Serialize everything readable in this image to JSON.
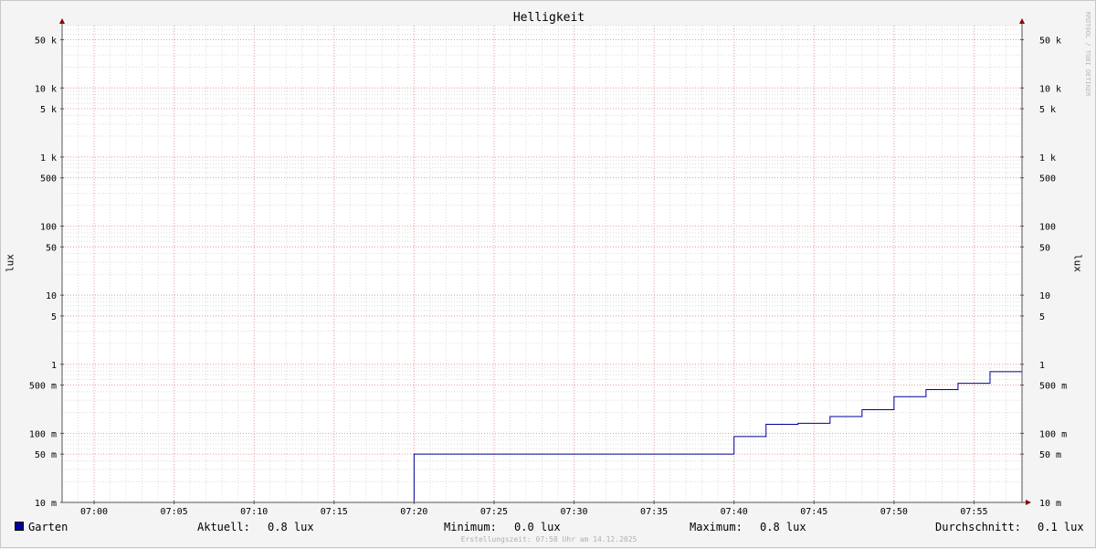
{
  "chart_data": {
    "type": "line",
    "title": "Helligkeit",
    "ylabel": "lux",
    "yscale": "log",
    "ylim": [
      0.01,
      80000
    ],
    "xlim": [
      "06:58",
      "07:58"
    ],
    "x_ticks": [
      "07:00",
      "07:05",
      "07:10",
      "07:15",
      "07:20",
      "07:25",
      "07:30",
      "07:35",
      "07:40",
      "07:45",
      "07:50",
      "07:55"
    ],
    "y_ticks": [
      {
        "value": 0.01,
        "label": "10 m"
      },
      {
        "value": 0.05,
        "label": "50 m"
      },
      {
        "value": 0.1,
        "label": "100 m"
      },
      {
        "value": 0.5,
        "label": "500 m"
      },
      {
        "value": 1,
        "label": "1"
      },
      {
        "value": 5,
        "label": "5"
      },
      {
        "value": 10,
        "label": "10"
      },
      {
        "value": 50,
        "label": "50"
      },
      {
        "value": 100,
        "label": "100"
      },
      {
        "value": 500,
        "label": "500"
      },
      {
        "value": 1000,
        "label": "1 k"
      },
      {
        "value": 5000,
        "label": "5 k"
      },
      {
        "value": 10000,
        "label": "10 k"
      },
      {
        "value": 50000,
        "label": "50 k"
      }
    ],
    "grid": true,
    "series": [
      {
        "name": "Garten",
        "color": "#000099",
        "step": true,
        "points": [
          [
            "06:58",
            0.01
          ],
          [
            "07:20",
            0.05
          ],
          [
            "07:40",
            0.09
          ],
          [
            "07:42",
            0.135
          ],
          [
            "07:44",
            0.14
          ],
          [
            "07:46",
            0.175
          ],
          [
            "07:48",
            0.22
          ],
          [
            "07:50",
            0.34
          ],
          [
            "07:52",
            0.43
          ],
          [
            "07:54",
            0.53
          ],
          [
            "07:56",
            0.78
          ],
          [
            "07:58",
            0.78
          ]
        ]
      }
    ]
  },
  "legend": {
    "series_name": "Garten",
    "current_label": "Aktuell:",
    "current_value": "0.8 lux",
    "min_label": "Minimum:",
    "min_value": "0.0 lux",
    "max_label": "Maximum:",
    "max_value": "0.8 lux",
    "avg_label": "Durchschnitt:",
    "avg_value": "0.1 lux"
  },
  "footer": "Erstellungszeit: 07:58 Uhr am 14.12.2025",
  "watermark": "RRDTOOL / TOBI OETIKER"
}
